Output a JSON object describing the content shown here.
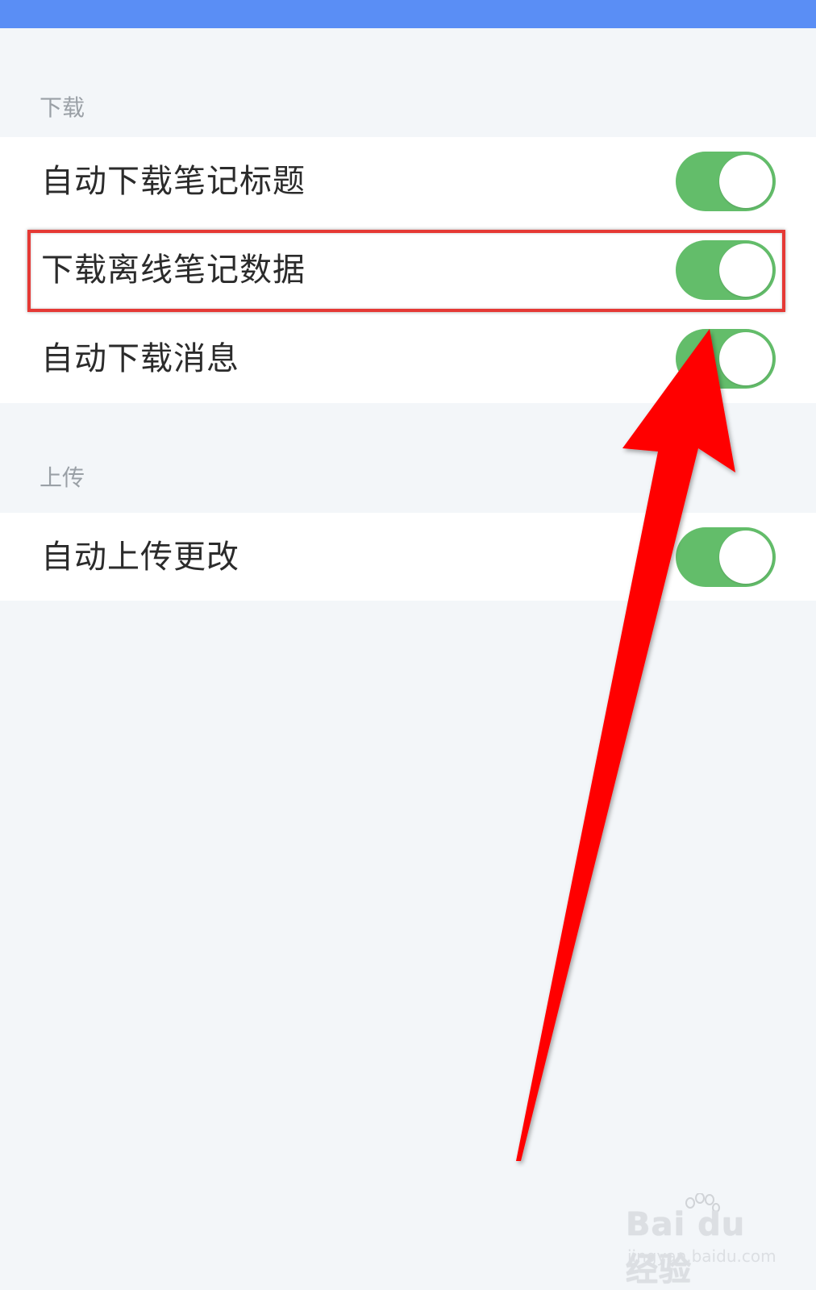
{
  "sections": {
    "download": {
      "label": "下载",
      "items": [
        {
          "label": "自动下载笔记标题",
          "toggle": "on"
        },
        {
          "label": "下载离线笔记数据",
          "toggle": "on"
        },
        {
          "label": "自动下载消息",
          "toggle": "on"
        }
      ]
    },
    "upload": {
      "label": "上传",
      "items": [
        {
          "label": "自动上传更改",
          "toggle": "on"
        }
      ]
    }
  },
  "watermark": {
    "brand": "Bai du 经验",
    "url": "jingyan.baidu.com"
  },
  "colors": {
    "top_bar": "#5a8ef5",
    "background": "#f3f6f9",
    "toggle_on": "#63bd6a",
    "highlight": "#e53935",
    "arrow": "#ff0000"
  }
}
